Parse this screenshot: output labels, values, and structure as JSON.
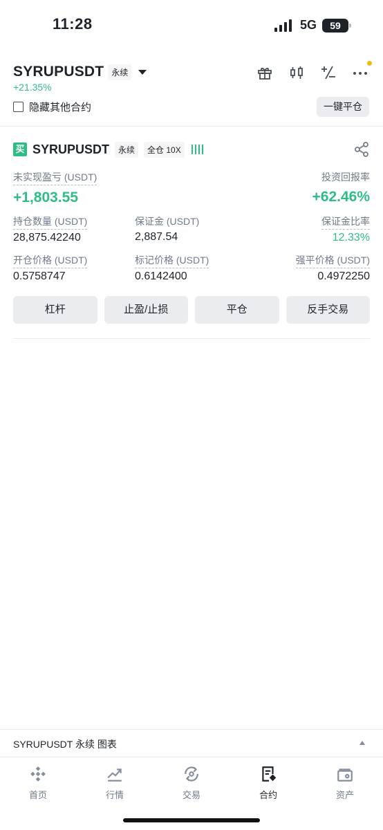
{
  "status_bar": {
    "time": "11:28",
    "network": "5G",
    "battery": "59"
  },
  "header": {
    "symbol": "SYRUPUSDT",
    "contract_type": "永续",
    "change": "+21.35%",
    "hide_others_label": "隐藏其他合约",
    "close_all_label": "一键平仓"
  },
  "position": {
    "side_badge": "买",
    "symbol": "SYRUPUSDT",
    "contract_type": "永续",
    "margin_mode": "全仓 10X",
    "unrealized_pnl_label": "未实现盈亏 (USDT)",
    "unrealized_pnl": "+1,803.55",
    "roi_label": "投资回报率",
    "roi": "+62.46%",
    "size_label": "持仓数量 (USDT)",
    "size": "28,875.42240",
    "margin_label": "保证金 (USDT)",
    "margin": "2,887.54",
    "margin_ratio_label": "保证金比率",
    "margin_ratio": "12.33%",
    "entry_price_label": "开仓价格 (USDT)",
    "entry_price": "0.5758747",
    "mark_price_label": "标记价格 (USDT)",
    "mark_price": "0.6142400",
    "liq_price_label": "强平价格 (USDT)",
    "liq_price": "0.4972250",
    "actions": [
      "杠杆",
      "止盈/止损",
      "平仓",
      "反手交易"
    ]
  },
  "chart_strip": {
    "label": "SYRUPUSDT 永续  图表"
  },
  "nav": {
    "items": [
      {
        "label": "首页",
        "icon": "binance-logo-icon"
      },
      {
        "label": "行情",
        "icon": "trend-chart-icon"
      },
      {
        "label": "交易",
        "icon": "trade-swap-icon"
      },
      {
        "label": "合约",
        "icon": "futures-doc-icon"
      },
      {
        "label": "资产",
        "icon": "wallet-icon"
      }
    ],
    "active": "合约"
  },
  "colors": {
    "green": "#2ebd85",
    "yellow": "#f0b90b",
    "text": "#1e2329",
    "muted": "#707a8a"
  }
}
